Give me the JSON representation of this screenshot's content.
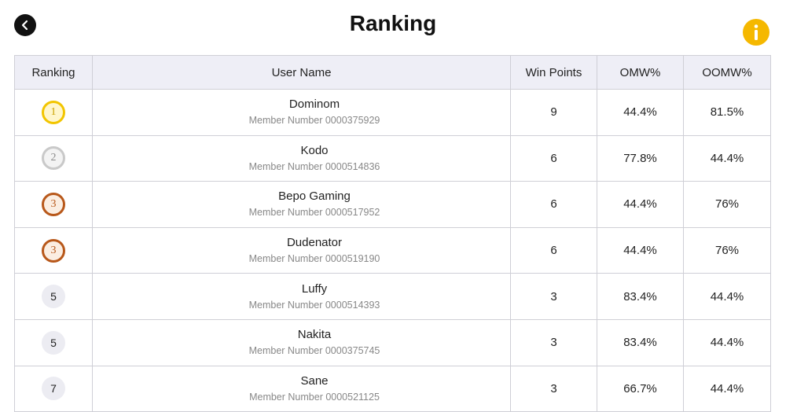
{
  "header": {
    "title": "Ranking",
    "info_label": "i"
  },
  "table": {
    "columns": [
      "Ranking",
      "User Name",
      "Win Points",
      "OMW%",
      "OOMW%"
    ],
    "rows": [
      {
        "rank": "1",
        "medal": "gold",
        "name": "Dominom",
        "member": "Member Number 0000375929",
        "win_points": "9",
        "omw": "44.4%",
        "oomw": "81.5%"
      },
      {
        "rank": "2",
        "medal": "silver",
        "name": "Kodo",
        "member": "Member Number 0000514836",
        "win_points": "6",
        "omw": "77.8%",
        "oomw": "44.4%"
      },
      {
        "rank": "3",
        "medal": "bronze",
        "name": "Bepo Gaming",
        "member": "Member Number 0000517952",
        "win_points": "6",
        "omw": "44.4%",
        "oomw": "76%"
      },
      {
        "rank": "3",
        "medal": "bronze",
        "name": "Dudenator",
        "member": "Member Number 0000519190",
        "win_points": "6",
        "omw": "44.4%",
        "oomw": "76%"
      },
      {
        "rank": "5",
        "medal": "none",
        "name": "Luffy",
        "member": "Member Number 0000514393",
        "win_points": "3",
        "omw": "83.4%",
        "oomw": "44.4%"
      },
      {
        "rank": "5",
        "medal": "none",
        "name": "Nakita",
        "member": "Member Number 0000375745",
        "win_points": "3",
        "omw": "83.4%",
        "oomw": "44.4%"
      },
      {
        "rank": "7",
        "medal": "none",
        "name": "Sane",
        "member": "Member Number 0000521125",
        "win_points": "3",
        "omw": "66.7%",
        "oomw": "44.4%"
      }
    ]
  },
  "colors": {
    "header_bg": "#eeeef6",
    "border": "#cfcfd6",
    "info_button": "#f5b800",
    "back_button": "#111111",
    "gold": "#f2c500",
    "silver": "#c9c9c9",
    "bronze": "#b8581a"
  },
  "icons": {
    "back": "chevron-left-icon",
    "info": "info-icon"
  }
}
